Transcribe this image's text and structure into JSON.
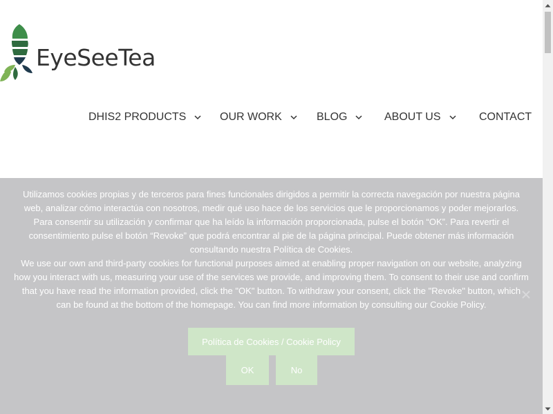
{
  "brand": {
    "name": "EyeSeeTea",
    "colors": {
      "dark_green": "#2f6b3f",
      "mid_green": "#3e8e4a",
      "light_green": "#7fb356",
      "navy": "#1f3a4d"
    }
  },
  "nav": {
    "items": [
      {
        "label": "DHIS2 PRODUCTS",
        "has_dropdown": true
      },
      {
        "label": "OUR WORK",
        "has_dropdown": true
      },
      {
        "label": "BLOG",
        "has_dropdown": true
      },
      {
        "label": "ABOUT US",
        "has_dropdown": true
      },
      {
        "label": "CONTACT",
        "has_dropdown": false
      }
    ]
  },
  "cookie_banner": {
    "text_es": "Utilizamos cookies propias y de terceros para fines funcionales dirigidos a permitir la correcta navegación por nuestra página web, analizar cómo interactúa con nosotros, medir qué uso hace de los servicios que le proporcionamos y poder mejorarlos. Para consentir su utilización y confirmar que ha leído la información proporcionada, pulse el botón “OK”. Para revertir el consentimiento pulse el botón “Revoke” que podrá encontrar al pie de la página principal. Puede obtener más información consultando nuestra Política de Cookies.",
    "text_en": "We use our own and third-party cookies for functional purposes aimed at enabling proper navigation on our website, analyzing how you interact with us, measuring your use of the services we provide, and improving them. To consent to their use and confirm that you have read the information provided, click the \"OK\" button. To withdraw your consent, click the \"Revoke\" button, which can be found at the bottom of the homepage. You can find more information by consulting our Cookie Policy.",
    "policy_button": "Política de Cookies / Cookie Policy",
    "ok_button": "OK",
    "no_button": "No",
    "background": "#c5c5c7",
    "button_color": "#cfe6c8",
    "close_icon": "close-icon"
  }
}
